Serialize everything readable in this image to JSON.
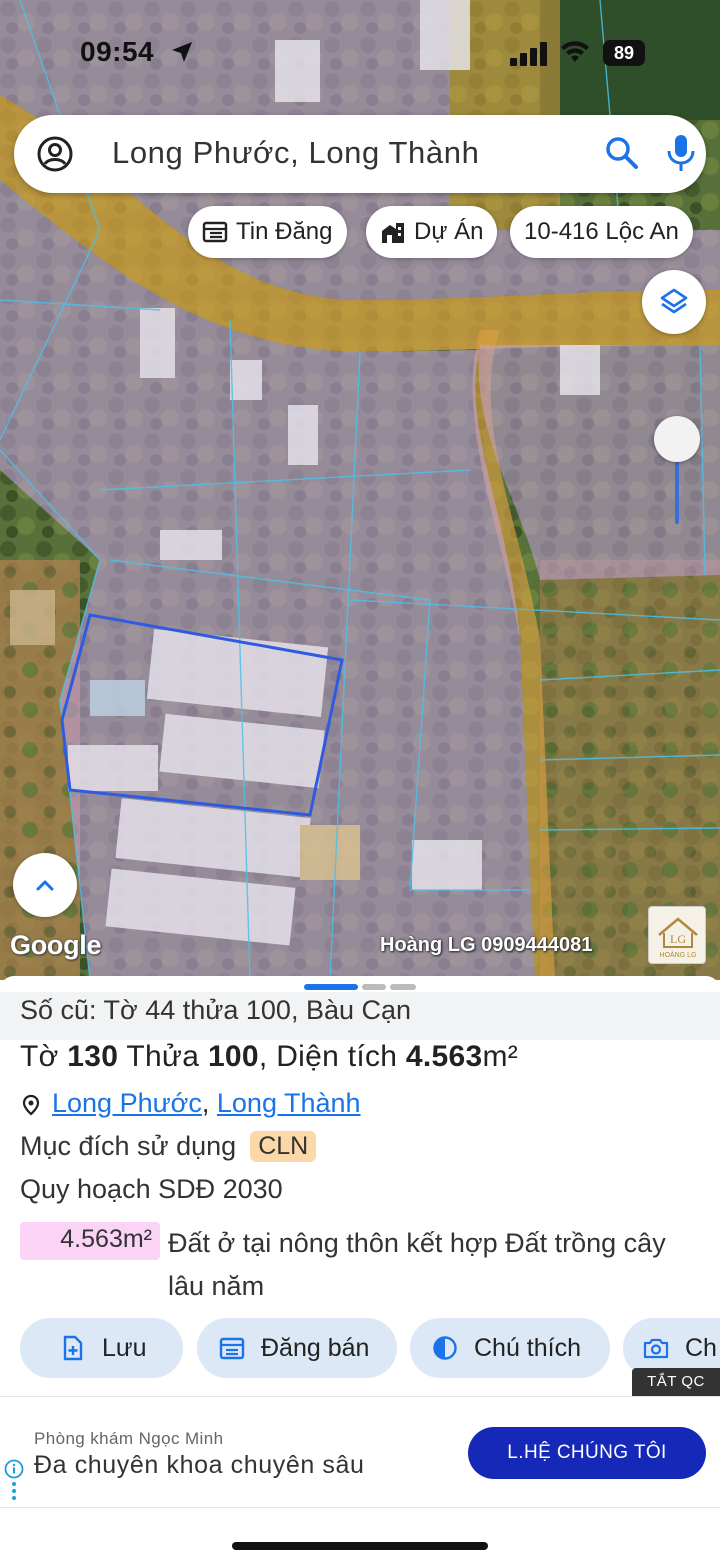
{
  "status_bar": {
    "time": "09:54",
    "battery": "89"
  },
  "search": {
    "query": "Long Phước, Long Thành"
  },
  "chips": [
    {
      "label": "Tin Đăng",
      "icon": "listing-icon"
    },
    {
      "label": "Dự Án",
      "icon": "building-icon"
    },
    {
      "label": "10-416 Lộc An",
      "icon": ""
    }
  ],
  "map": {
    "attribution": "Google",
    "watermark": "Hoàng LG 0909444081",
    "badge_text": "LG",
    "badge_subtext": "HOÀNG LG"
  },
  "sheet": {
    "old_info": "Số cũ: Tờ 44 thửa 100, Bàu Cạn",
    "plot": {
      "sheet_label": "Tờ",
      "sheet_no": "130",
      "parcel_label": "Thửa",
      "parcel_no": "100",
      "area_label": "Diện tích",
      "area_value": "4.563",
      "area_unit": "m²"
    },
    "address": {
      "ward": "Long Phước",
      "district": "Long Thành",
      "separator": ", "
    },
    "purpose_label": "Mục đích sử dụng",
    "purpose_code": "CLN",
    "plan_label": "Quy hoạch SDĐ 2030",
    "plan_area": "4.563m²",
    "plan_desc": "Đất ở tại nông thôn kết hợp Đất trồng cây lâu năm",
    "actions": [
      {
        "label": "Lưu",
        "icon": "save-icon"
      },
      {
        "label": "Đăng bán",
        "icon": "post-icon"
      },
      {
        "label": "Chú thích",
        "icon": "legend-icon"
      },
      {
        "label": "Ch",
        "icon": "camera-icon"
      }
    ],
    "hide_ads": "TẮT QC"
  },
  "ad": {
    "sponsor": "Phòng khám Ngọc Minh",
    "headline": "Đa chuyên khoa chuyên sâu",
    "cta": "L.HỆ CHÚNG TÔI"
  },
  "colors": {
    "accent": "#1a73e8",
    "plan_overlay": "#c8a2e8",
    "road_overlay": "#d8a040",
    "parcel_outline": "#2f5be0",
    "cta": "#1528b8"
  }
}
